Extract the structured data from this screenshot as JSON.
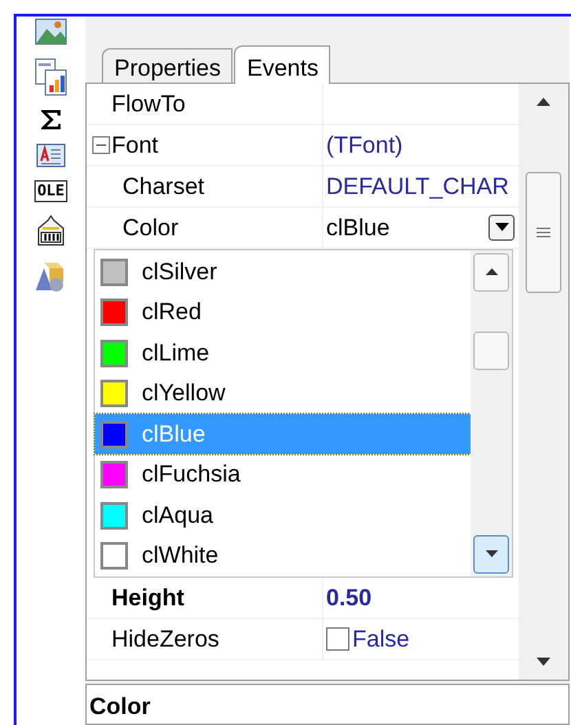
{
  "toolbar": [
    {
      "kind": "picture"
    },
    {
      "kind": "report"
    },
    {
      "kind": "sigma"
    },
    {
      "kind": "document"
    },
    {
      "kind": "label",
      "text": "OLE"
    },
    {
      "kind": "register"
    },
    {
      "kind": "shapes"
    }
  ],
  "tabs": [
    {
      "label": "Properties",
      "selected": false
    },
    {
      "label": "Events",
      "selected": true
    }
  ],
  "properties": [
    {
      "name": "FlowTo",
      "non_default": false
    },
    {
      "name": "Font",
      "value": "(TFont)",
      "non_default": false,
      "expanded": true,
      "children": [
        {
          "name": "Charset",
          "value": "DEFAULT_CHAR",
          "non_default": false
        },
        {
          "name": "Color",
          "value": "clBlue",
          "non_default": false,
          "editing": true,
          "dropdown": [
            {
              "name": "clSilver",
              "color": "#c0c0c0",
              "selected": false
            },
            {
              "name": "clRed",
              "color": "#ff0000",
              "selected": false
            },
            {
              "name": "clLime",
              "color": "#00ff00",
              "selected": false
            },
            {
              "name": "clYellow",
              "color": "#ffff00",
              "selected": false
            },
            {
              "name": "clBlue",
              "color": "#0000ff",
              "selected": true
            },
            {
              "name": "clFuchsia",
              "color": "#ff00ff",
              "selected": false
            },
            {
              "name": "clAqua",
              "color": "#00ffff",
              "selected": false
            },
            {
              "name": "clWhite",
              "color": "#ffffff",
              "selected": false
            }
          ]
        }
      ]
    },
    {
      "name": "Height",
      "value": "0.50",
      "non_default": true
    },
    {
      "name": "HideZeros",
      "value": "False",
      "non_default": false,
      "checked": false
    }
  ],
  "description": "Color"
}
